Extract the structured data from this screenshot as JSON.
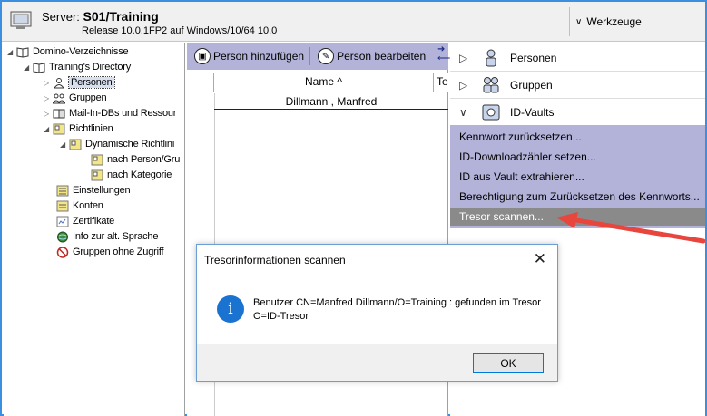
{
  "header": {
    "server_label": "Server:",
    "server_name": "S01/Training",
    "release": "Release 10.0.1FP2 auf Windows/10/64 10.0",
    "tools_label": "Werkzeuge"
  },
  "tree": {
    "root": "Domino-Verzeichnisse",
    "directory": "Training's Directory",
    "items": [
      "Personen",
      "Gruppen",
      "Mail-In-DBs und Ressour",
      "Richtlinien",
      "Dynamische Richtlini",
      "nach Person/Gru",
      "nach Kategorie",
      "Einstellungen",
      "Konten",
      "Zertifikate",
      "Info zur alt. Sprache",
      "Gruppen ohne Zugriff"
    ]
  },
  "view": {
    "actions": [
      "Person hinzufügen",
      "Person bearbeiten"
    ],
    "column_name": "Name ^",
    "column_te": "Te",
    "rows": [
      "Dillmann , Manfred"
    ]
  },
  "panel": {
    "sections": [
      "Personen",
      "Gruppen",
      "ID-Vaults"
    ],
    "menu": [
      "Kennwort zurücksetzen...",
      "ID-Downloadzähler setzen...",
      "ID aus Vault extrahieren...",
      "Berechtigung zum Zurücksetzen des Kennworts...",
      "Tresor scannen..."
    ]
  },
  "dialog": {
    "title": "Tresorinformationen scannen",
    "message": "Benutzer CN=Manfred Dillmann/O=Training : gefunden im Tresor O=ID-Tresor",
    "ok": "OK"
  },
  "colors": {
    "accent": "#3c8fe0",
    "action_bar": "#b3b3d9",
    "highlight": "#8a8a8a",
    "arrow": "#e8453c"
  }
}
